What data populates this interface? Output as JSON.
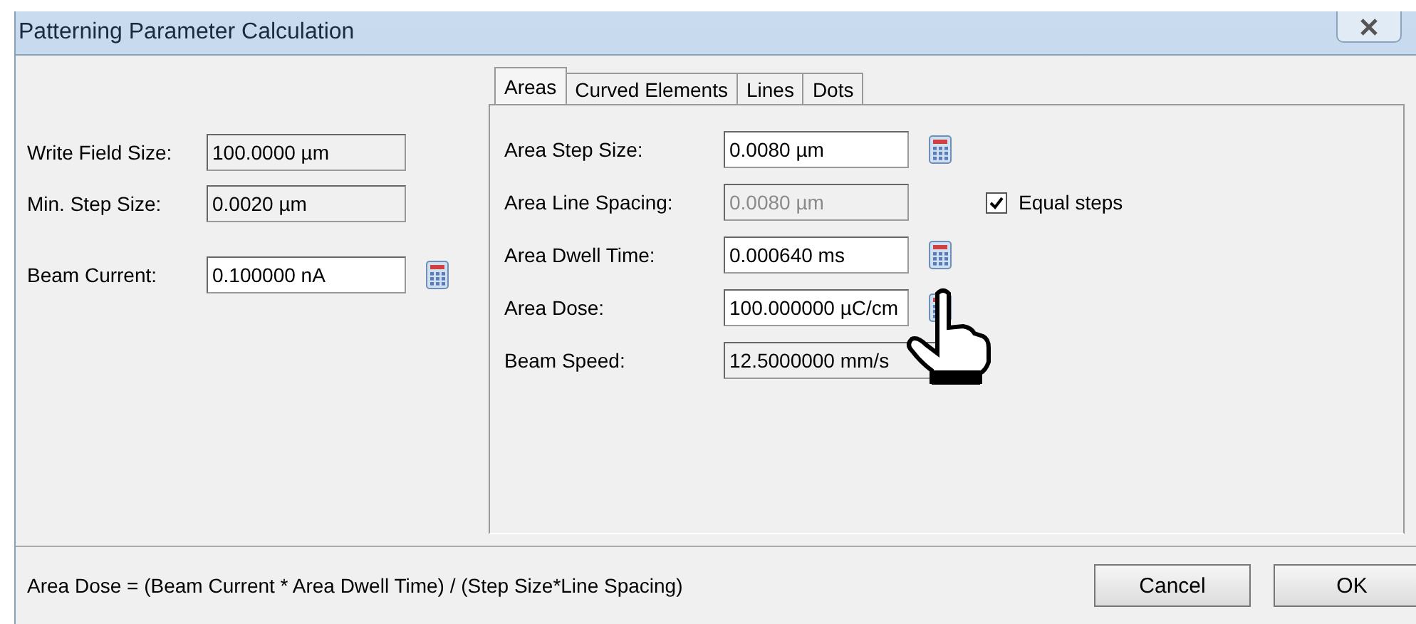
{
  "window": {
    "title": "Patterning Parameter Calculation"
  },
  "left_fields": [
    {
      "label": "Write Field Size:",
      "value": "100.0000 µm",
      "disabled": true,
      "calculator": false
    },
    {
      "label": "Min. Step Size:",
      "value": "0.0020 µm",
      "disabled": true,
      "calculator": false
    },
    {
      "label": "Beam Current:",
      "value": "0.100000 nA",
      "disabled": false,
      "calculator": true
    }
  ],
  "tabs": [
    {
      "label": "Areas",
      "selected": true
    },
    {
      "label": "Curved Elements",
      "selected": false
    },
    {
      "label": "Lines",
      "selected": false
    },
    {
      "label": "Dots",
      "selected": false
    }
  ],
  "area_fields": [
    {
      "label": "Area Step Size:",
      "value": "0.0080 µm",
      "disabled": false,
      "calculator": true
    },
    {
      "label": "Area Line Spacing:",
      "value": "0.0080 µm",
      "disabled": true,
      "calculator": false
    },
    {
      "label": "Area Dwell Time:",
      "value": "0.000640 ms",
      "disabled": false,
      "calculator": true
    },
    {
      "label": "Area Dose:",
      "value": "100.000000 µC/cm",
      "disabled": false,
      "calculator": true
    },
    {
      "label": "Beam Speed:",
      "value": "12.5000000 mm/s",
      "disabled": true,
      "calculator": false
    }
  ],
  "equal_steps": {
    "label": "Equal steps",
    "checked": true
  },
  "formula": "Area Dose = (Beam Current * Area Dwell Time) / (Step Size*Line Spacing)",
  "buttons": [
    "Cancel",
    "OK"
  ]
}
